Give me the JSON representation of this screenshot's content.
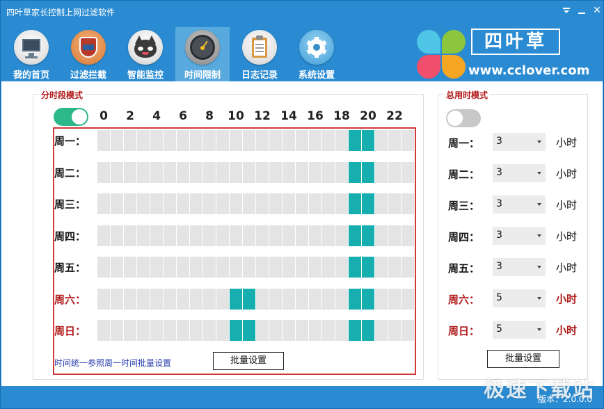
{
  "window": {
    "title": "四叶草家长控制上网过滤软件",
    "version_label": "版本：2.0.0.0",
    "watermark": "极速下载站"
  },
  "nav": {
    "items": [
      {
        "label": "我的首页",
        "icon": "monitor-icon"
      },
      {
        "label": "过滤拦截",
        "icon": "shield-icon"
      },
      {
        "label": "智能监控",
        "icon": "cat-face-icon"
      },
      {
        "label": "时间限制",
        "icon": "clock-icon",
        "active": true
      },
      {
        "label": "日志记录",
        "icon": "clipboard-icon"
      },
      {
        "label": "系统设置",
        "icon": "gear-icon"
      }
    ]
  },
  "logo": {
    "name": "四叶草",
    "url": "www.cclover.com"
  },
  "segment_mode": {
    "title": "分时段模式",
    "enabled": true,
    "hour_labels": [
      "0",
      "2",
      "4",
      "6",
      "8",
      "10",
      "12",
      "14",
      "16",
      "18",
      "20",
      "22"
    ],
    "days": [
      {
        "label": "周一：",
        "weekend": false,
        "on_hours": [
          19,
          20
        ]
      },
      {
        "label": "周二：",
        "weekend": false,
        "on_hours": [
          19,
          20
        ]
      },
      {
        "label": "周三：",
        "weekend": false,
        "on_hours": [
          19,
          20
        ]
      },
      {
        "label": "周四：",
        "weekend": false,
        "on_hours": [
          19,
          20
        ]
      },
      {
        "label": "周五：",
        "weekend": false,
        "on_hours": [
          19,
          20
        ]
      },
      {
        "label": "周六：",
        "weekend": true,
        "on_hours": [
          10,
          11,
          19,
          20
        ]
      },
      {
        "label": "周日：",
        "weekend": true,
        "on_hours": [
          10,
          11,
          19,
          20
        ]
      }
    ],
    "note": "时间统一参照周一时间批量设置",
    "batch_button": "批量设置"
  },
  "total_mode": {
    "title": "总用时模式",
    "enabled": false,
    "unit": "小时",
    "days": [
      {
        "label": "周一：",
        "value": "3",
        "weekend": false
      },
      {
        "label": "周二：",
        "value": "3",
        "weekend": false
      },
      {
        "label": "周三：",
        "value": "3",
        "weekend": false
      },
      {
        "label": "周四：",
        "value": "3",
        "weekend": false
      },
      {
        "label": "周五：",
        "value": "3",
        "weekend": false
      },
      {
        "label": "周六：",
        "value": "5",
        "weekend": true
      },
      {
        "label": "周日：",
        "value": "5",
        "weekend": true
      }
    ],
    "batch_button": "批量设置"
  },
  "colors": {
    "accent": "#2a8bd2",
    "active_cell": "#16aeae",
    "inactive_cell": "#e4e4e4",
    "weekend_text": "#b01818",
    "toggle_on": "#2db88a"
  }
}
